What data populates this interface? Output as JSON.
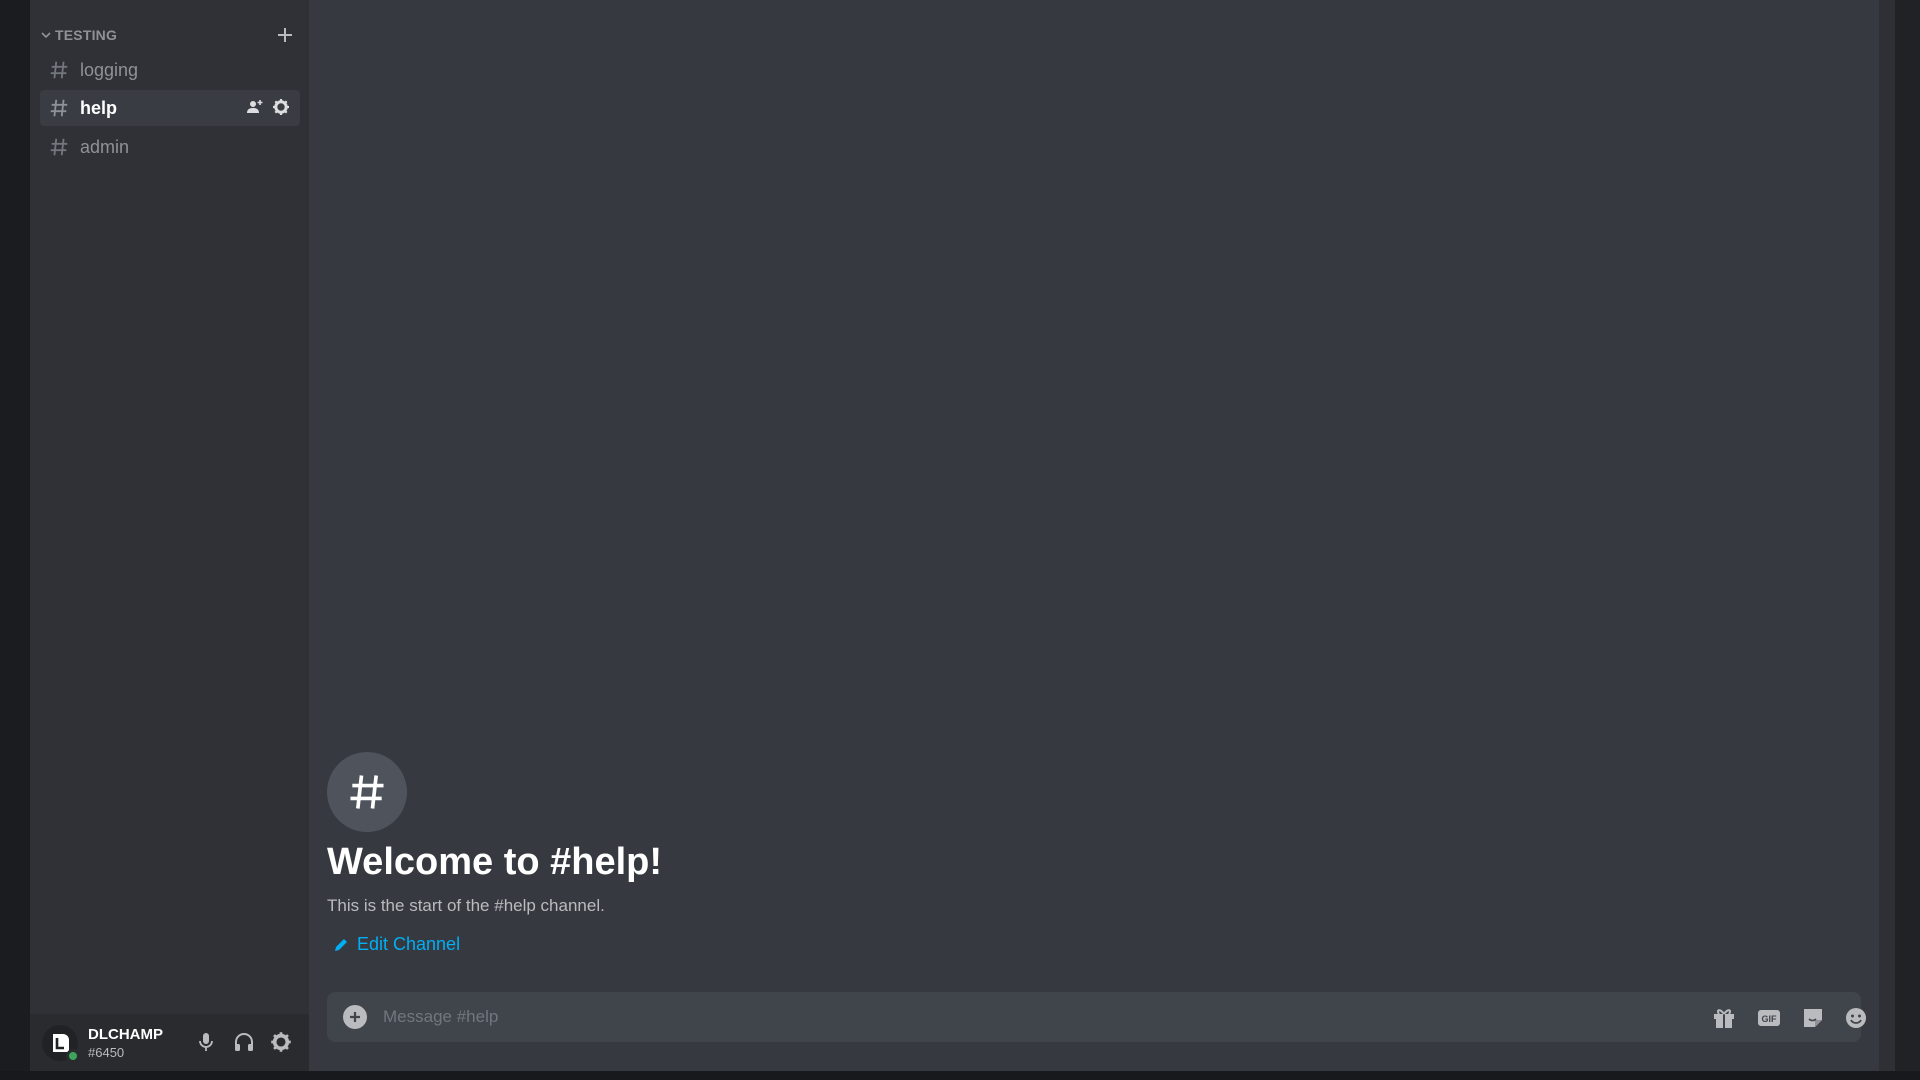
{
  "sidebar": {
    "category": {
      "label": "TESTING",
      "chevron_icon": "chevron-down-icon",
      "add_icon": "plus-icon"
    },
    "channels": [
      {
        "label": "logging",
        "active": false,
        "icon": "text-channel-hash-icon"
      },
      {
        "label": "help",
        "active": true,
        "icon": "text-channel-hash-icon",
        "tools": [
          "invite-member-icon",
          "gear-icon"
        ]
      },
      {
        "label": "admin",
        "active": false,
        "icon": "text-channel-hash-icon"
      }
    ]
  },
  "user_panel": {
    "username": "DLCHAMP",
    "tag": "#6450",
    "status": "online",
    "status_color": "#3ba55c",
    "buttons": [
      "microphone-icon",
      "headphones-icon",
      "gear-icon"
    ]
  },
  "main": {
    "welcome": {
      "icon": "hash-icon",
      "title": "Welcome to #help!",
      "subtitle": "This is the start of the #help channel.",
      "edit_label": "Edit Channel"
    },
    "composer": {
      "placeholder": "Message #help",
      "value": "",
      "left_icon": "add-circle-icon",
      "right_icons": [
        "gift-icon",
        "gif-icon",
        "sticker-icon",
        "emoji-icon"
      ]
    }
  },
  "colors": {
    "sidebar_bg": "#2f3136",
    "main_bg": "#36393f",
    "composer_bg": "#40444b",
    "link": "#00aff4"
  }
}
